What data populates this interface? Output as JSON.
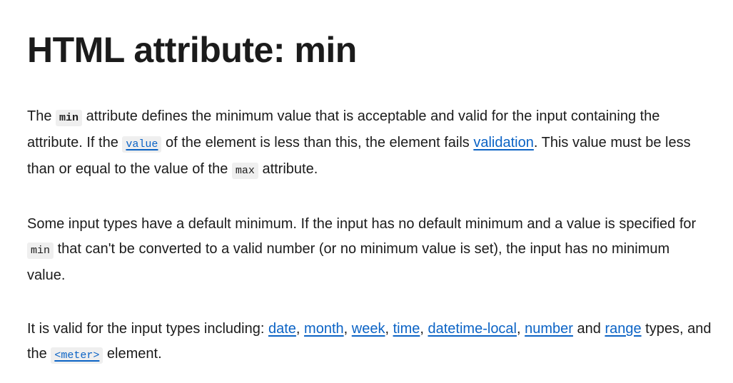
{
  "title": "HTML attribute: min",
  "p1": {
    "t1": "The ",
    "code_min": "min",
    "t2": " attribute defines the minimum value that is acceptable and valid for the input containing the attribute. If the ",
    "code_value": "value",
    "t3": " of the element is less than this, the element fails ",
    "link_validation": "validation",
    "t4": ". This value must be less than or equal to the value of the ",
    "code_max": "max",
    "t5": " attribute."
  },
  "p2": {
    "t1": "Some input types have a default minimum. If the input has no default minimum and a value is specified for ",
    "code_min": "min",
    "t2": " that can't be converted to a valid number (or no minimum value is set), the input has no minimum value."
  },
  "p3": {
    "t1": "It is valid for the input types including: ",
    "links": [
      "date",
      "month",
      "week",
      "time",
      "datetime-local",
      "number",
      "range"
    ],
    "sep_comma": ", ",
    "sep_and": " and ",
    "t2": " types, and the ",
    "code_meter": "<meter>",
    "t3": " element."
  },
  "colors": {
    "text": "#1b1b1b",
    "link": "#0b63c5",
    "code_bg": "#efefef"
  }
}
